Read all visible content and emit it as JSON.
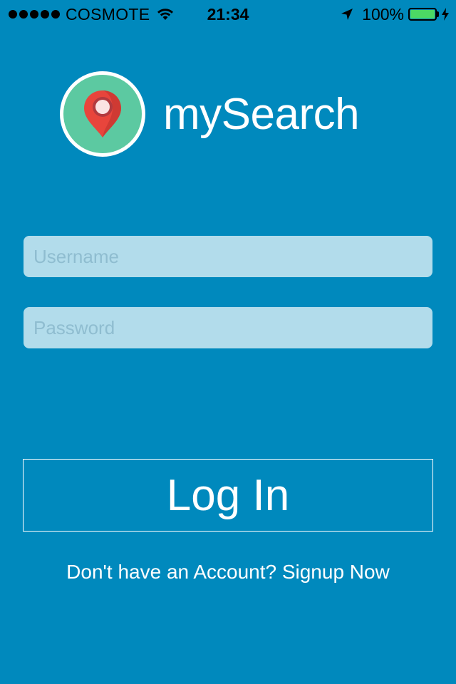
{
  "status_bar": {
    "carrier": "COSMOTE",
    "time": "21:34",
    "battery_percent": "100%",
    "battery_level": 1.0,
    "icons": [
      "signal-dots",
      "wifi-icon",
      "location-arrow-icon",
      "battery-icon",
      "charging-bolt-icon"
    ]
  },
  "app": {
    "title": "mySearch",
    "logo_icon": "map-pin-icon"
  },
  "login_form": {
    "username_placeholder": "Username",
    "username_value": "",
    "password_placeholder": "Password",
    "password_value": "",
    "login_label": "Log In"
  },
  "signup": {
    "text": "Don't have an Account? Signup Now"
  },
  "colors": {
    "background": "#0089bd",
    "input_background": "#b2dceb",
    "logo_circle": "#5cc9a1",
    "pin_red": "#e8453c",
    "battery_green": "#4cd964"
  }
}
